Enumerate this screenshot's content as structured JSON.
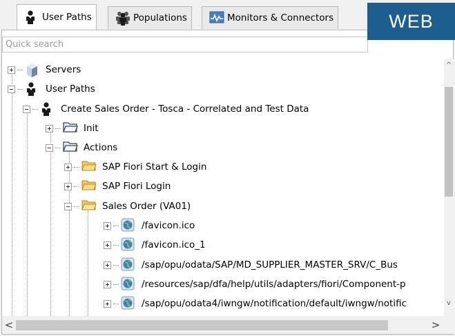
{
  "tabs": [
    {
      "label": "User Paths",
      "icon": "user-path-icon",
      "active": true
    },
    {
      "label": "Populations",
      "icon": "population-icon",
      "active": false
    },
    {
      "label": "Monitors & Connectors",
      "icon": "monitor-icon",
      "active": false
    }
  ],
  "badge": {
    "text": "WEB",
    "color": "#1c5f8e"
  },
  "search": {
    "placeholder": "Quick search",
    "value": ""
  },
  "tree": {
    "servers": {
      "label": "Servers",
      "icon": "server-icon",
      "expanded": false
    },
    "user_paths": {
      "label": "User Paths",
      "icon": "user-path-icon",
      "expanded": true
    },
    "create_sales_order": {
      "label": "Create Sales Order - Tosca - Correlated and Test Data",
      "icon": "user-path-icon",
      "expanded": true
    },
    "init": {
      "label": "Init",
      "icon": "folder-icon",
      "expanded": false
    },
    "actions": {
      "label": "Actions",
      "icon": "folder-icon",
      "expanded": true
    },
    "fiori_start_login": {
      "label": "SAP Fiori Start & Login",
      "icon": "folder-yellow-icon",
      "expanded": false
    },
    "fiori_login": {
      "label": "SAP Fiori Login",
      "icon": "folder-yellow-icon",
      "expanded": false
    },
    "sales_order": {
      "label": "Sales Order (VA01)",
      "icon": "folder-yellow-open-icon",
      "expanded": true
    },
    "requests": [
      {
        "label": "/favicon.ico",
        "icon": "globe-icon"
      },
      {
        "label": "/favicon.ico_1",
        "icon": "globe-icon"
      },
      {
        "label": "/sap/opu/odata/SAP/MD_SUPPLIER_MASTER_SRV/C_Bus",
        "icon": "globe-icon"
      },
      {
        "label": "/resources/sap/dfa/help/utils/adapters/fiori/Component-p",
        "icon": "globe-icon"
      },
      {
        "label": "/sap/opu/odata4/iwngw/notification/default/iwngw/notific",
        "icon": "globe-icon"
      }
    ]
  },
  "colors": {
    "folder_gray": "#e7edf4",
    "folder_yellow": "#f7d67a",
    "globe": "#3d7fc4"
  }
}
